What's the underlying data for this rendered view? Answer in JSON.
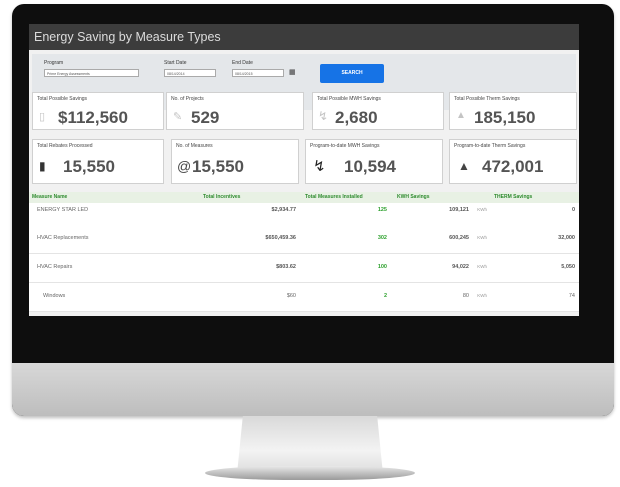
{
  "app": {
    "title": "Energy Saving by Measure Types"
  },
  "filters": {
    "program_label": "Program",
    "program_value": "Prime Energy Assessments",
    "start_date_label": "Start Date",
    "start_date_value": "08/14/2014",
    "end_date_label": "End Date",
    "end_date_value": "08/14/2015",
    "search_label": "SEARCH"
  },
  "kpis": [
    {
      "label": "Total Possible Savings",
      "value": "$112,560",
      "icon": "money-icon"
    },
    {
      "label": "No. of Projects",
      "value": "529",
      "icon": "thumbs-up-icon"
    },
    {
      "label": "Total Possible MWH Savings",
      "value": "2,680",
      "icon": "lightning-icon"
    },
    {
      "label": "Total Possible Therm Savings",
      "value": "185,150",
      "icon": "flame-icon"
    },
    {
      "label": "Total Rebates Processed",
      "value": "15,550",
      "icon": "money-icon"
    },
    {
      "label": "No. of Measures",
      "value": "15,550",
      "icon": "at-icon"
    },
    {
      "label": "Program-to-date MWH Savings",
      "value": "10,594",
      "icon": "lightning-icon"
    },
    {
      "label": "Program-to-date Therm Savings",
      "value": "472,001",
      "icon": "flame-icon"
    }
  ],
  "table": {
    "headers": [
      "Measure Name",
      "Total Incentives",
      "Total Measures Installed",
      "KWH Savings",
      "THERM Savings"
    ],
    "rows": [
      {
        "name": "ENERGY STAR LED",
        "incentives": "$2,934.77",
        "measures": "125",
        "kwh": "109,121",
        "kwh_unit": "KWh",
        "therm": "0"
      },
      {
        "name": "HVAC Replacements",
        "incentives": "$650,459.36",
        "measures": "302",
        "kwh": "600,245",
        "kwh_unit": "KWh",
        "therm": "32,000"
      },
      {
        "name": "HVAC Repairs",
        "incentives": "$803.62",
        "measures": "100",
        "kwh": "94,022",
        "kwh_unit": "KWh",
        "therm": "5,050"
      },
      {
        "name": "Windows",
        "incentives": "$60",
        "measures": "2",
        "kwh": "80",
        "kwh_unit": "KWh",
        "therm": "74"
      }
    ]
  },
  "colors": {
    "accent": "#1673e6",
    "header_green": "#2e8b2e",
    "titlebar": "#3c3c3c"
  }
}
